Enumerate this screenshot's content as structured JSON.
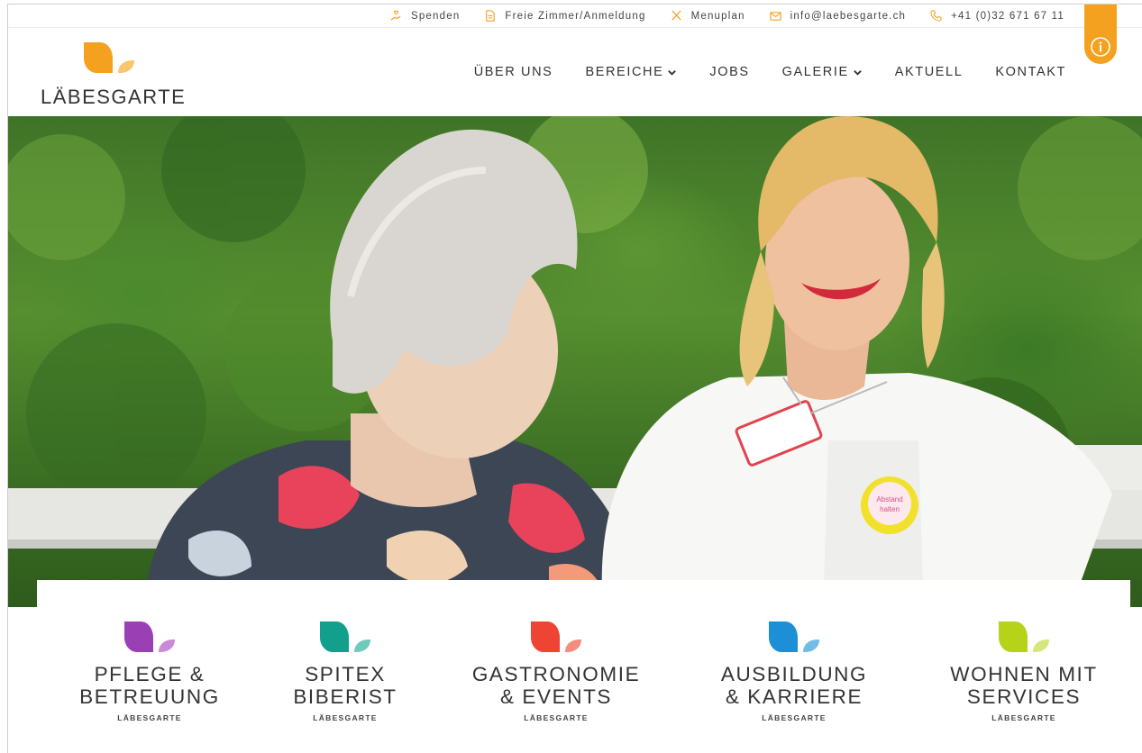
{
  "topbar": {
    "items": [
      {
        "label": "Spenden",
        "icon": "donation-hand-icon"
      },
      {
        "label": "Freie Zimmer/Anmeldung",
        "icon": "document-icon"
      },
      {
        "label": "Menuplan",
        "icon": "cutlery-icon"
      },
      {
        "label": "info@laebesgarte.ch",
        "icon": "mail-icon"
      },
      {
        "label": "+41 (0)32 671 67 11",
        "icon": "phone-icon"
      }
    ]
  },
  "brand": {
    "name": "LÄBESGARTE",
    "accent": "#f4a11f"
  },
  "nav": {
    "items": [
      {
        "label": "ÜBER UNS"
      },
      {
        "label": "BEREICHE"
      },
      {
        "label": "JOBS"
      },
      {
        "label": "GALERIE"
      },
      {
        "label": "AKTUELL"
      },
      {
        "label": "KONTAKT"
      }
    ]
  },
  "hero": {
    "badge_line1": "Abstand",
    "badge_line2": "halten"
  },
  "categories": [
    {
      "line1": "PFLEGE &",
      "line2": "BETREUUNG",
      "sub": "LÄBESGARTE",
      "color": "#9b3fb5",
      "color_light": "#c98bd8"
    },
    {
      "line1": "SPITEX",
      "line2": "BIBERIST",
      "sub": "LÄBESGARTE",
      "color": "#12a08c",
      "color_light": "#6fcabb"
    },
    {
      "line1": "GASTRONOMIE",
      "line2": "& EVENTS",
      "sub": "LÄBESGARTE",
      "color": "#ee4434",
      "color_light": "#f58c7e"
    },
    {
      "line1": "AUSBILDUNG",
      "line2": "& KARRIERE",
      "sub": "LÄBESGARTE",
      "color": "#1c8fd6",
      "color_light": "#71bce8"
    },
    {
      "line1": "WOHNEN MIT",
      "line2": "SERVICES",
      "sub": "LÄBESGARTE",
      "color": "#b6d319",
      "color_light": "#d6e67a"
    }
  ]
}
